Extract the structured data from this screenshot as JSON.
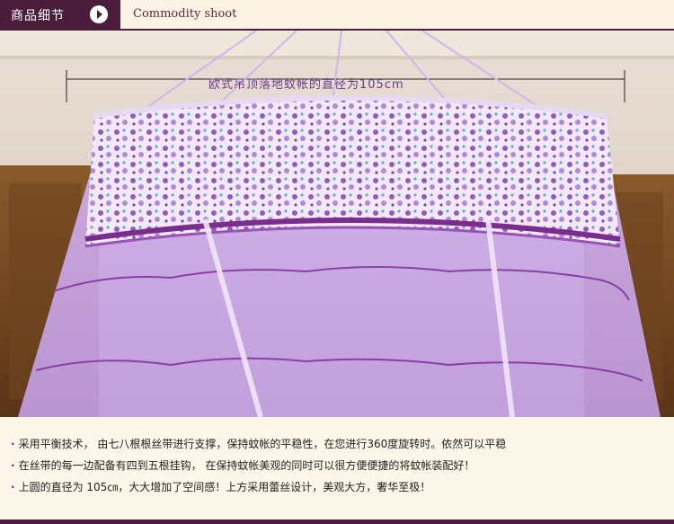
{
  "header": {
    "tag_label": "商品细节",
    "title": "Commodity shoot"
  },
  "photo": {
    "measure_label": "欧式吊顶落地蚊帐的直径为105cm"
  },
  "features": [
    "采用平衡技术， 由七八根根丝带进行支撑，保持蚊帐的平稳性，在您进行360度旋转时。依然可以平稳",
    "在丝带的每一边配备有四到五根挂钩， 在保持蚊帐美观的同时可以很方便便捷的将蚊帐装配好！",
    "上圆的直径为 105㎝，大大增加了空间感！上方采用蕾丝设计，美观大方，奢华至极！"
  ],
  "colors": {
    "brand": "#4a1d3a",
    "net": "#c9a4e4",
    "accent": "#7b2d8e"
  }
}
